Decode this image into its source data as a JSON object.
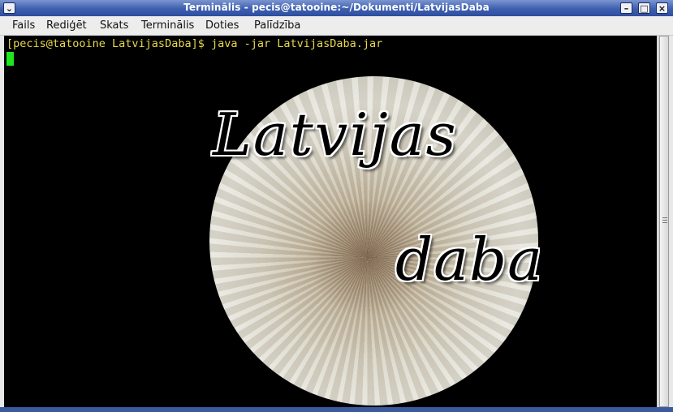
{
  "window": {
    "title": "Terminālis - pecis@tatooine:~/Dokumenti/LatvijasDaba",
    "buttons": {
      "menu": "⌄",
      "minimize": "–",
      "maximize": "□",
      "close": "×"
    }
  },
  "menubar": {
    "items": [
      {
        "label": "Fails"
      },
      {
        "label": "Rediģēt"
      },
      {
        "label": "Skats"
      },
      {
        "label": "Terminālis"
      },
      {
        "label": "Doties"
      },
      {
        "label": "Palīdzība"
      }
    ]
  },
  "terminal": {
    "prompt_line": "[pecis@tatooine LatvijasDaba]$ java -jar LatvijasDaba.jar"
  },
  "splash": {
    "line1": "Latvijas",
    "line2": "daba"
  },
  "colors": {
    "titlebar": "#3e5fb0",
    "terminal_bg": "#000000",
    "prompt_text": "#e8d84a",
    "cursor": "#1ee61e"
  }
}
